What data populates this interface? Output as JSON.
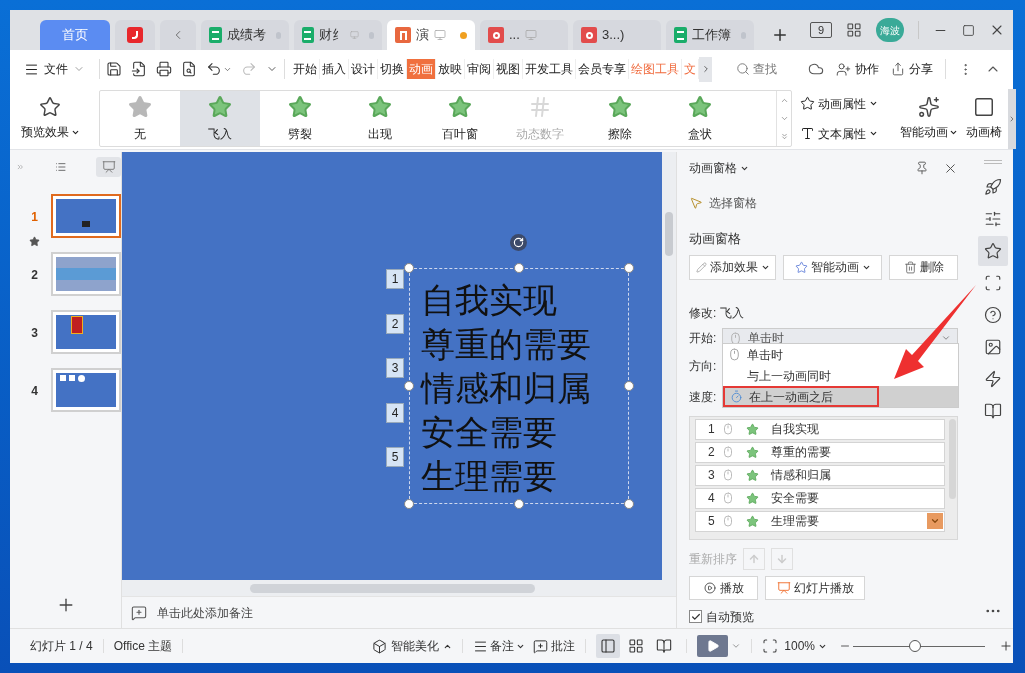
{
  "tabs": [
    {
      "kind": "home",
      "label": "首页",
      "selected": false
    },
    {
      "kind": "app",
      "selected": false
    },
    {
      "kind": "back",
      "selected": false
    },
    {
      "kind": "sheet",
      "label": "成绩考",
      "selected": false,
      "dot": true,
      "cast": false
    },
    {
      "kind": "sheet",
      "label": "财纟",
      "selected": false,
      "dot": true,
      "cast": true
    },
    {
      "kind": "slides",
      "label": "演",
      "selected": true,
      "dot": true,
      "cast": true
    },
    {
      "kind": "pdf",
      "label": "...",
      "selected": false,
      "dot": false,
      "cast": true
    },
    {
      "kind": "pdf",
      "label": "3...)",
      "selected": false,
      "dot": false,
      "cast": false
    },
    {
      "kind": "sheet",
      "label": "工作簿",
      "selected": false,
      "dot": true,
      "cast": false
    }
  ],
  "window_controls": {
    "badge": "9",
    "avatar": "海波"
  },
  "toolbar": {
    "file_menu": "文件",
    "ribbon_tabs": [
      {
        "label": "开始",
        "kind": "normal",
        "selected": false
      },
      {
        "label": "插入",
        "kind": "normal",
        "selected": false
      },
      {
        "label": "设计",
        "kind": "normal",
        "selected": false
      },
      {
        "label": "切换",
        "kind": "normal",
        "selected": false
      },
      {
        "label": "动画",
        "kind": "normal",
        "selected": true
      },
      {
        "label": "放映",
        "kind": "normal",
        "selected": false
      },
      {
        "label": "审阅",
        "kind": "normal",
        "selected": false
      },
      {
        "label": "视图",
        "kind": "normal",
        "selected": false
      },
      {
        "label": "开发工具",
        "kind": "normal",
        "selected": false
      },
      {
        "label": "会员专享",
        "kind": "normal",
        "selected": false
      },
      {
        "label": "绘图工具",
        "kind": "context",
        "selected": false
      },
      {
        "label": "文",
        "kind": "context",
        "selected": false
      }
    ],
    "search": "查找",
    "collab": "协作",
    "share": "分享"
  },
  "ribbon": {
    "preview": "预览效果",
    "effects": [
      {
        "label": "无",
        "kind": "none",
        "selected": false,
        "disabled": false
      },
      {
        "label": "飞入",
        "kind": "star",
        "selected": true,
        "disabled": false
      },
      {
        "label": "劈裂",
        "kind": "star",
        "selected": false,
        "disabled": false
      },
      {
        "label": "出现",
        "kind": "star",
        "selected": false,
        "disabled": false
      },
      {
        "label": "百叶窗",
        "kind": "star",
        "selected": false,
        "disabled": false
      },
      {
        "label": "动态数字",
        "kind": "number",
        "selected": false,
        "disabled": true
      },
      {
        "label": "擦除",
        "kind": "star",
        "selected": false,
        "disabled": false
      },
      {
        "label": "盒状",
        "kind": "star",
        "selected": false,
        "disabled": false
      }
    ],
    "anim_props": "动画属性",
    "text_props": "文本属性",
    "smart_anim": "智能动画",
    "pane_button": "动画椅"
  },
  "slides": [
    {
      "number": "1",
      "kind": "title",
      "selected": true
    },
    {
      "number": "2",
      "kind": "banner",
      "selected": false
    },
    {
      "number": "3",
      "kind": "image",
      "selected": false
    },
    {
      "number": "4",
      "kind": "shapes",
      "selected": false
    }
  ],
  "canvas": {
    "lines": [
      {
        "tag": "1",
        "text": "自我实现"
      },
      {
        "tag": "2",
        "text": "尊重的需要"
      },
      {
        "tag": "3",
        "text": "情感和归属"
      },
      {
        "tag": "4",
        "text": "安全需要"
      },
      {
        "tag": "5",
        "text": "生理需要"
      }
    ]
  },
  "notes": {
    "placeholder": "单击此处添加备注"
  },
  "pane": {
    "title": "动画窗格",
    "select_pane": "选择窗格",
    "section": "动画窗格",
    "add_effect": "添加效果",
    "smart_anim": "智能动画",
    "delete": "删除",
    "modify": "修改: 飞入",
    "start_label": "开始:",
    "start_value": "单击时",
    "direction_label": "方向:",
    "speed_label": "速度:",
    "options": [
      {
        "label": "单击时",
        "kind": "click",
        "selected": false,
        "highlighted": false
      },
      {
        "label": "与上一动画同时",
        "kind": "with",
        "selected": false,
        "highlighted": false
      },
      {
        "label": "在上一动画之后",
        "kind": "after",
        "selected": true,
        "highlighted": true
      }
    ],
    "items": [
      {
        "number": "1",
        "name": "自我实现",
        "selected": false
      },
      {
        "number": "2",
        "name": "尊重的需要",
        "selected": false
      },
      {
        "number": "3",
        "name": "情感和归属",
        "selected": false
      },
      {
        "number": "4",
        "name": "安全需要",
        "selected": false
      },
      {
        "number": "5",
        "name": "生理需要",
        "selected": true
      }
    ],
    "reorder": "重新排序",
    "play": "播放",
    "slideshow": "幻灯片播放",
    "auto_preview": {
      "label": "自动预览",
      "checked": true
    }
  },
  "status_bar": {
    "slide": "幻灯片 1 / 4",
    "theme": "Office 主题",
    "beautify": "智能美化",
    "notes": "备注",
    "comment": "批注",
    "views": [
      {
        "kind": "normal",
        "selected": true
      },
      {
        "kind": "sorter",
        "selected": false
      },
      {
        "kind": "reading",
        "selected": false
      }
    ],
    "zoom": "100%",
    "zoom_slider": {
      "level": 0.47
    }
  }
}
